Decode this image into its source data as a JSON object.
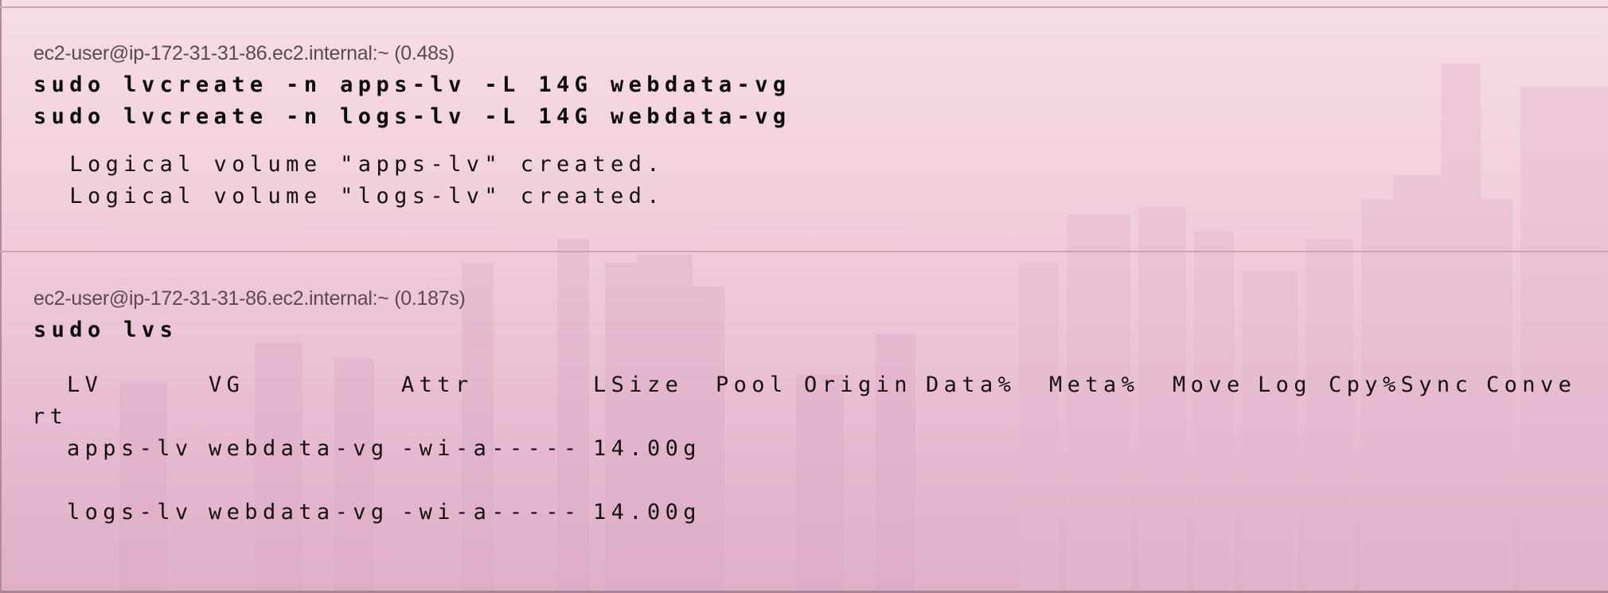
{
  "blocks": [
    {
      "prompt": "ec2-user@ip-172-31-31-86.ec2.internal:~ (0.48s)",
      "commands": [
        "sudo lvcreate -n apps-lv -L 14G webdata-vg",
        "sudo lvcreate -n logs-lv -L 14G webdata-vg"
      ],
      "output": [
        "  Logical volume \"apps-lv\" created.",
        "  Logical volume \"logs-lv\" created."
      ]
    },
    {
      "prompt": "ec2-user@ip-172-31-31-86.ec2.internal:~ (0.187s)",
      "commands": [
        "sudo lvs"
      ],
      "table": {
        "headers": [
          "LV",
          "VG",
          "Attr",
          "LSize",
          "Pool",
          "Origin",
          "Data%",
          "Meta%",
          "Move",
          "Log",
          "Cpy%Sync",
          "Conve",
          "rt"
        ],
        "rows": [
          [
            "apps-lv",
            "webdata-vg",
            "-wi-a-----",
            "14.00g"
          ],
          [
            "logs-lv",
            "webdata-vg",
            "-wi-a-----",
            "14.00g"
          ]
        ]
      }
    }
  ],
  "colors": {
    "background_top": "#f6dde6",
    "background_bottom": "#dfb0c8",
    "prompt_text": "#5b4a52",
    "command_text": "#0a0a0a",
    "divider": "#c9a6b6"
  }
}
